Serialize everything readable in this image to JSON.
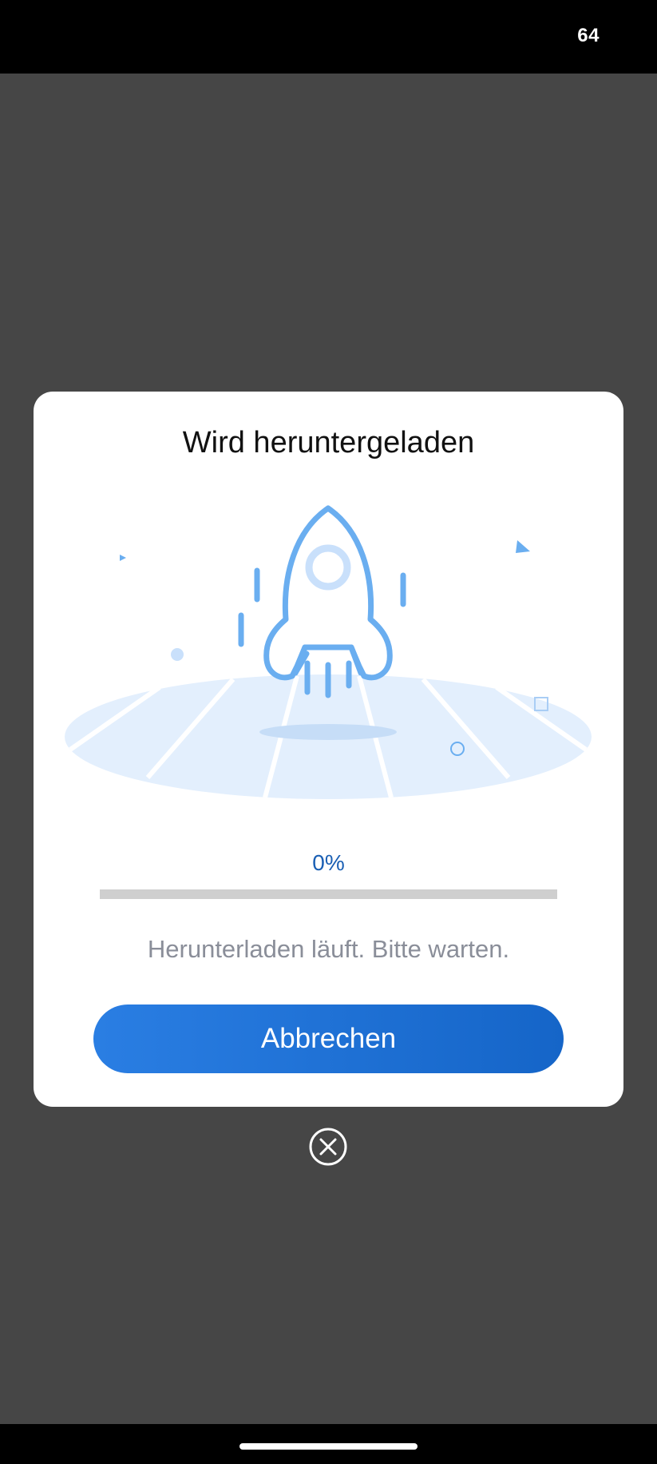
{
  "status_bar": {
    "battery": "64"
  },
  "dialog": {
    "title": "Wird heruntergeladen",
    "illustration_icon": "rocket-launch-illustration",
    "progress_text": "0%",
    "progress_fraction": 0,
    "message": "Herunterladen läuft. Bitte warten.",
    "cancel_label": "Abbrechen"
  },
  "close_icon": "close-circle-icon",
  "colors": {
    "accent": "#1a73e8",
    "progress_text": "#1a5fb4",
    "illustration_blue": "#6aaef0",
    "illustration_light": "#e3effd"
  }
}
